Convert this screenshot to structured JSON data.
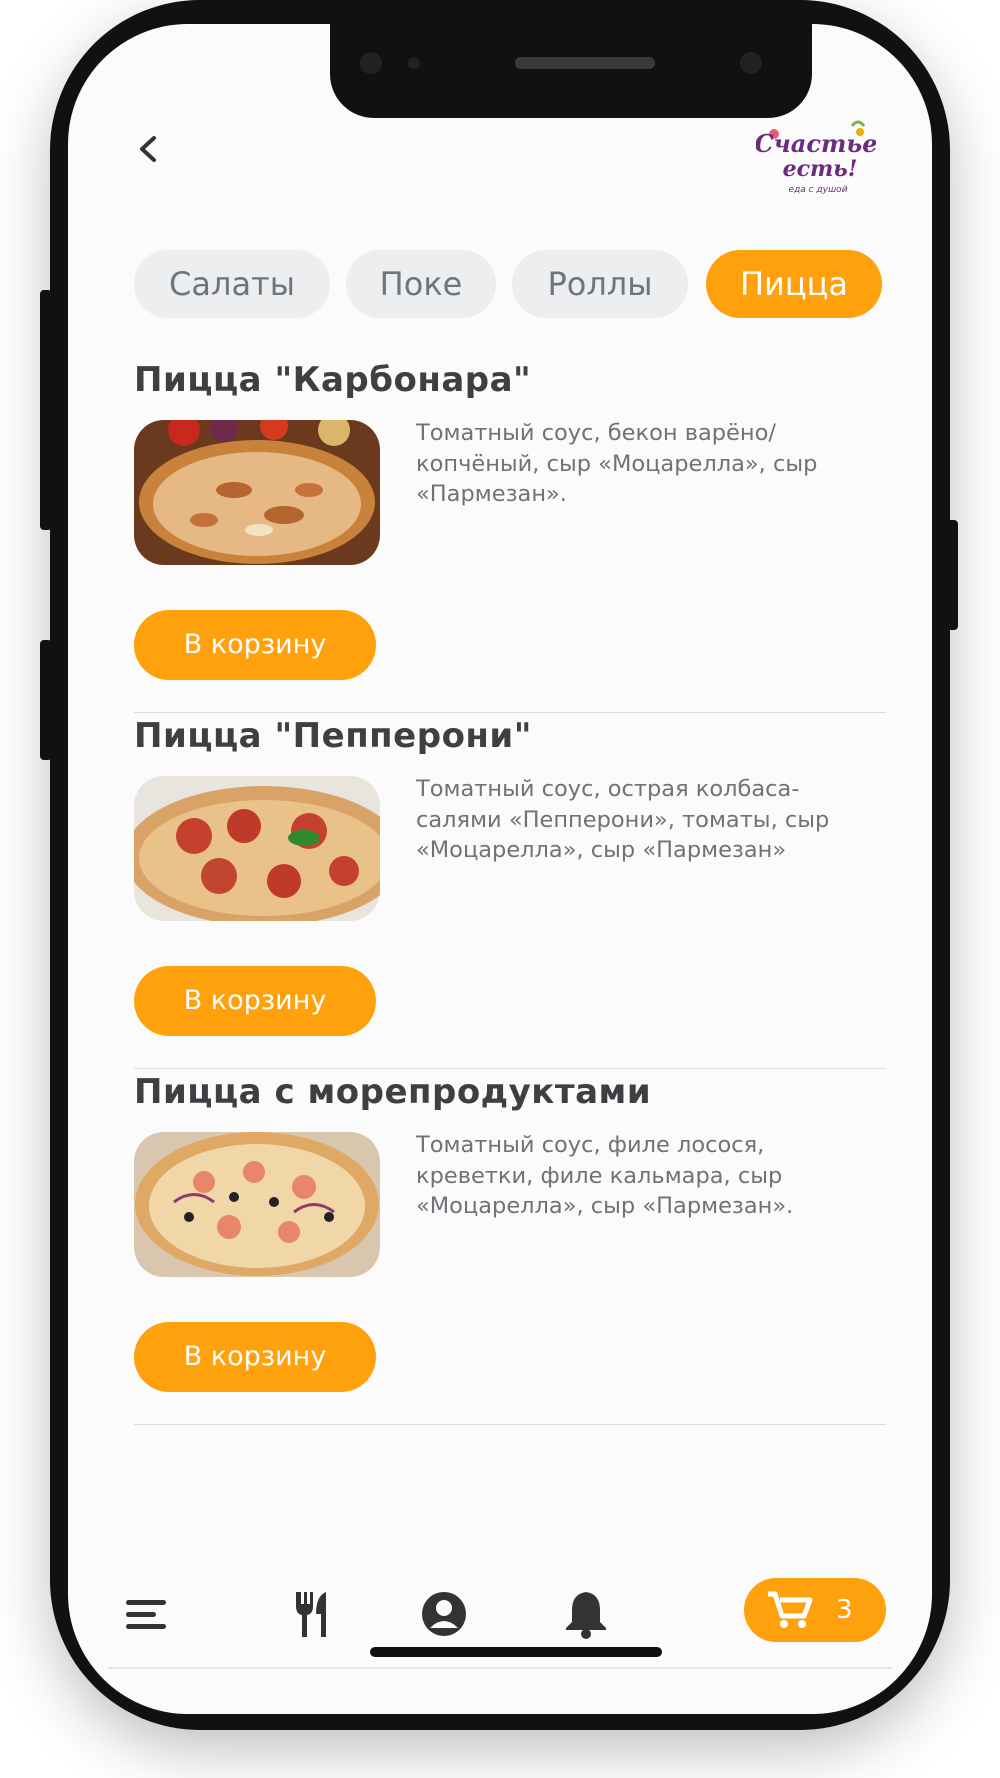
{
  "header": {
    "back_icon": "chevron-left-icon",
    "logo_text_line1": "Счастье",
    "logo_text_line2": "есть!",
    "logo_tagline": "еда с душой"
  },
  "tabs": [
    {
      "label": "Салаты",
      "active": false
    },
    {
      "label": "Поке",
      "active": false
    },
    {
      "label": "Роллы",
      "active": false
    },
    {
      "label": "Пицца",
      "active": true
    }
  ],
  "products": [
    {
      "title": "Пицца \"Карбонара\"",
      "description": "Томатный соус, бекон варёно/копчёный, сыр «Моцарелла», сыр «Пармезан».",
      "button": "В корзину"
    },
    {
      "title": "Пицца \"Пепперони\"",
      "description": "Томатный соус, острая колбаса-салями «Пепперони», томаты, сыр «Моцарелла», сыр «Пармезан»",
      "button": "В корзину"
    },
    {
      "title": "Пицца с морепродуктами",
      "description": "Томатный соус, филе лосося, креветки, филе кальмара, сыр «Моцарелла», сыр «Пармезан».",
      "button": "В корзину"
    }
  ],
  "bottom_nav": {
    "items": [
      {
        "icon": "menu-icon"
      },
      {
        "icon": "fork-knife-icon"
      },
      {
        "icon": "profile-icon"
      },
      {
        "icon": "bell-icon"
      }
    ],
    "cart": {
      "icon": "cart-icon",
      "count": "3"
    }
  },
  "colors": {
    "accent": "#ffa10d",
    "tab_inactive_bg": "#eceeef",
    "text_dark": "#3d3f42",
    "text_muted": "#6e7378"
  }
}
